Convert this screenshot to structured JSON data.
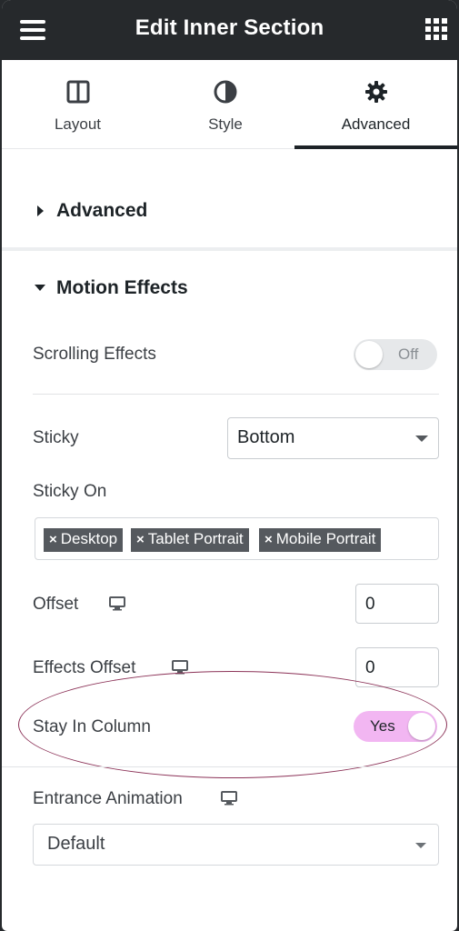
{
  "header": {
    "title": "Edit Inner Section",
    "menu_icon": "hamburger-menu-icon",
    "apps_icon": "grid-apps-icon"
  },
  "tabs": [
    {
      "label": "Layout",
      "icon": "columns-layout-icon",
      "active": false
    },
    {
      "label": "Style",
      "icon": "half-circle-contrast-icon",
      "active": false
    },
    {
      "label": "Advanced",
      "icon": "gear-icon",
      "active": true
    }
  ],
  "sections": {
    "advanced": {
      "title": "Advanced",
      "expanded": false
    },
    "motion_effects": {
      "title": "Motion Effects",
      "expanded": true
    }
  },
  "motion": {
    "scrolling_effects": {
      "label": "Scrolling Effects",
      "value": "Off",
      "on": false
    },
    "sticky": {
      "label": "Sticky",
      "value": "Bottom"
    },
    "sticky_on": {
      "label": "Sticky On",
      "tags": [
        {
          "x": "×",
          "text": "Desktop"
        },
        {
          "x": "×",
          "text": "Tablet Portrait"
        },
        {
          "x": "×",
          "text": "Mobile Portrait"
        }
      ]
    },
    "offset": {
      "label": "Offset",
      "value": "0",
      "icon": "desktop-monitor-icon"
    },
    "effects_offset": {
      "label": "Effects Offset",
      "value": "0",
      "icon": "desktop-monitor-icon"
    },
    "stay_in_column": {
      "label": "Stay In Column",
      "value": "Yes",
      "on": true
    },
    "entrance_animation": {
      "label": "Entrance Animation",
      "value": "Default",
      "icon": "desktop-monitor-icon"
    }
  },
  "colors": {
    "header_bg": "#26292c",
    "toggle_on": "#f2b6f2",
    "tag_bg": "#55595e",
    "highlight_ellipse": "#8c3358"
  }
}
